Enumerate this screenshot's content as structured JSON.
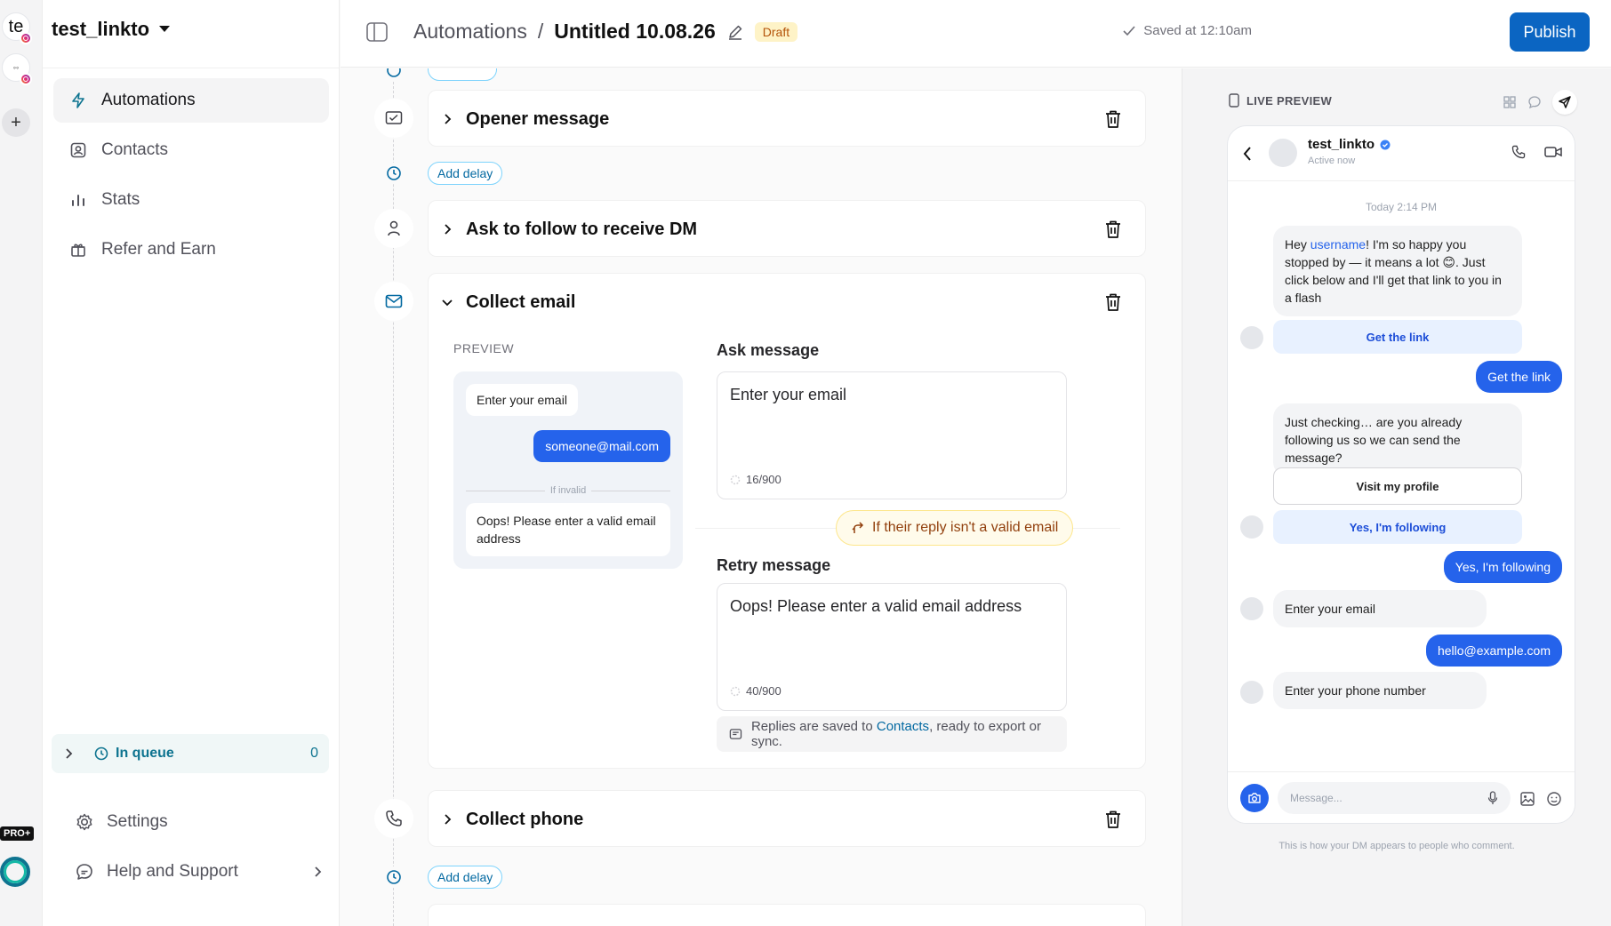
{
  "accounts": {
    "current_initials": "te",
    "add_symbol": "+",
    "plan_badge": "PRO+"
  },
  "sidebar": {
    "workspace_name": "test_linkto",
    "items": [
      {
        "label": "Automations",
        "icon": "lightning-icon",
        "active": true
      },
      {
        "label": "Contacts",
        "icon": "contact-icon",
        "active": false
      },
      {
        "label": "Stats",
        "icon": "bar-chart-icon",
        "active": false
      },
      {
        "label": "Refer and Earn",
        "icon": "gift-icon",
        "active": false
      }
    ],
    "queue": {
      "label": "In queue",
      "count": "0"
    },
    "settings_label": "Settings",
    "help_label": "Help and Support"
  },
  "header": {
    "breadcrumb_root": "Automations",
    "separator": "/",
    "title": "Untitled 10.08.26",
    "status_badge": "Draft",
    "saved_text": "Saved at 12:10am",
    "publish_label": "Publish"
  },
  "canvas": {
    "add_delay_label": "Add delay",
    "steps": [
      {
        "title": "Opener message",
        "icon": "message-check-icon"
      },
      {
        "title": "Ask to follow to receive DM",
        "icon": "person-icon"
      },
      {
        "title": "Collect email",
        "icon": "mail-icon"
      },
      {
        "title": "Collect phone",
        "icon": "phone-icon"
      }
    ],
    "collect_email": {
      "preview_label": "PREVIEW",
      "preview_prompt": "Enter your email",
      "preview_answer": "someone@mail.com",
      "preview_divider": "If invalid",
      "preview_retry": "Oops! Please enter a valid email address",
      "ask_label": "Ask message",
      "ask_value": "Enter your email",
      "ask_counter": "16/900",
      "invalid_pill": "If their reply isn't a valid email",
      "retry_label": "Retry message",
      "retry_value": "Oops! Please enter a valid email address",
      "retry_counter": "40/900",
      "note_prefix": "Replies are saved to ",
      "note_link": "Contacts",
      "note_suffix": ", ready to export or sync."
    }
  },
  "live_preview": {
    "title": "LIVE PREVIEW",
    "account_name": "test_linkto",
    "account_status": "Active now",
    "timestamp": "Today 2:14 PM",
    "msg1_prefix": "Hey ",
    "msg1_highlight": "username",
    "msg1_rest": "! I'm so happy you stopped by — it means a lot 😊. Just click below and I'll get that link to you in a flash",
    "btn_get_link": "Get the link",
    "reply_get_link": "Get the link",
    "msg2": "Just checking… are you already following us so we can send the message?",
    "btn_visit": "Visit my profile",
    "btn_following": "Yes, I'm following",
    "reply_following": "Yes, I'm following",
    "msg3": "Enter your email",
    "reply_email": "hello@example.com",
    "msg4": "Enter your phone number",
    "compose_placeholder": "Message...",
    "footer": "This is how your DM appears to people who comment."
  },
  "colors": {
    "accent": "#0b65c2",
    "bubble_blue": "#2563eb",
    "teal": "#0e7490",
    "draft_bg": "#fef3c7"
  }
}
